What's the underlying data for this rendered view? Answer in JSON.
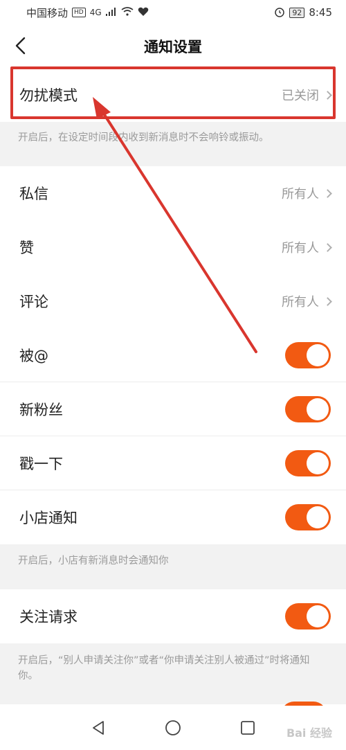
{
  "status_bar": {
    "carrier": "中国移动",
    "hd": "HD",
    "network": "4G",
    "battery": "92",
    "time": "8:45"
  },
  "nav": {
    "title": "通知设置",
    "back_icon": "back-arrow-icon"
  },
  "dnd": {
    "label": "勿扰模式",
    "value": "已关闭",
    "description": "开启后，在设定时间段内收到新消息时不会响铃或振动。"
  },
  "list_rows": [
    {
      "label": "私信",
      "value": "所有人"
    },
    {
      "label": "赞",
      "value": "所有人"
    },
    {
      "label": "评论",
      "value": "所有人"
    }
  ],
  "toggle_rows": [
    {
      "label": "被@",
      "on": true
    },
    {
      "label": "新粉丝",
      "on": true
    },
    {
      "label": "戳一下",
      "on": true
    },
    {
      "label": "小店通知",
      "on": true
    }
  ],
  "shop_description": "开启后，小店有新消息时会通知你",
  "follow_request": {
    "label": "关注请求",
    "on": true,
    "description": "开启后，“别人申请关注你”或者“你申请关注别人被通过”时将通知你。"
  },
  "watermark": "Bai 经验",
  "colors": {
    "toggle_on": "#f25a12",
    "annotation": "#d9362e"
  }
}
